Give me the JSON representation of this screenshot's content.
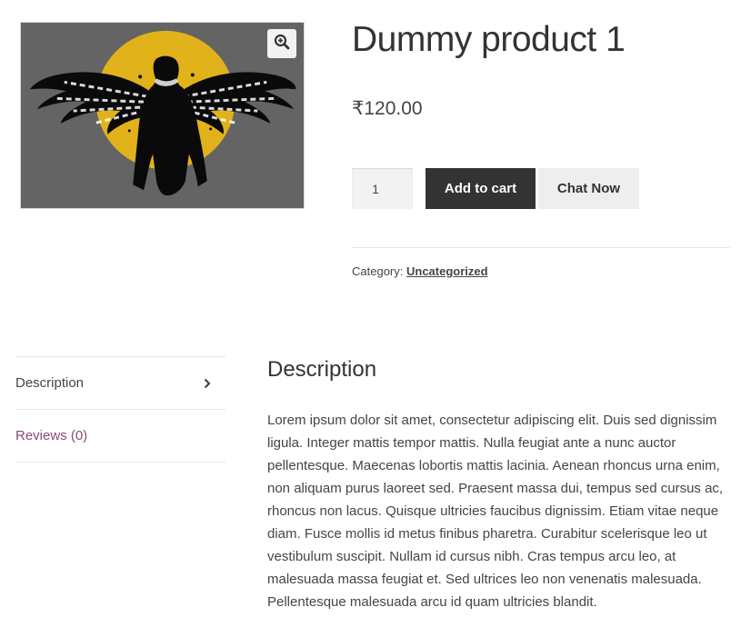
{
  "product": {
    "title": "Dummy product 1",
    "price": "₹120.00",
    "image_alt": "Winged figure silhouette in front of a yellow sun",
    "image_colors": {
      "background": "#646464",
      "sun": "#e2b21a",
      "figure": "#0a0a0a",
      "feathers": "#ffffff"
    }
  },
  "gallery": {
    "zoom_icon": "zoom-in-icon"
  },
  "cart_form": {
    "quantity": "1",
    "add_to_cart_label": "Add to cart",
    "chat_label": "Chat Now"
  },
  "meta": {
    "category_label": "Category:",
    "category_value": "Uncategorized"
  },
  "tabs": [
    {
      "label": "Description",
      "active": true,
      "icon": "chevron-right-icon"
    },
    {
      "label": "Reviews (0)",
      "active": false
    }
  ],
  "description": {
    "heading": "Description",
    "body": "Lorem ipsum dolor sit amet, consectetur adipiscing elit. Duis sed dignissim ligula. Integer mattis tempor mattis. Nulla feugiat ante a nunc auctor pellentesque. Maecenas lobortis mattis lacinia. Aenean rhoncus urna enim, non aliquam purus laoreet sed. Praesent massa dui, tempus sed cursus ac, rhoncus non lacus. Quisque ultricies faucibus dignissim. Etiam vitae neque diam. Fusce mollis id metus finibus pharetra. Curabitur scelerisque leo ut vestibulum suscipit. Nullam id cursus nibh. Cras tempus arcu leo, at malesuada massa feugiat et. Sed ultrices leo non venenatis malesuada. Pellentesque malesuada arcu id quam ultricies blandit."
  },
  "colors": {
    "button_dark": "#333333",
    "button_light": "#eeeeee",
    "link_purple": "#8a4a76",
    "text": "#43454b"
  }
}
